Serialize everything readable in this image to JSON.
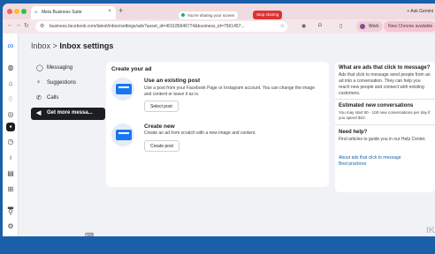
{
  "browser": {
    "tab_title": "Meta Business Suite",
    "new_tab": "+",
    "close": "×",
    "sharing_text": "You're sharing your screen",
    "stop_sharing": "Stop sharing",
    "ask_gemini": "+ Ask Gemini",
    "url": "business.facebook.com/latest/inbox/settings/ads?asset_id=401185646774&business_id=7561457...",
    "work_label": "Work",
    "chrome_available": "New Chrome available"
  },
  "page": {
    "breadcrumb_parent": "Inbox",
    "breadcrumb_sep": ">",
    "title": "Inbox settings"
  },
  "nav": {
    "items": [
      {
        "label": "Messaging",
        "icon": "chat-icon",
        "glyph": "◯"
      },
      {
        "label": "Suggestions",
        "icon": "lightbulb-icon",
        "glyph": "♀"
      },
      {
        "label": "Calls",
        "icon": "phone-icon",
        "glyph": "✆"
      },
      {
        "label": "Get more messa...",
        "icon": "megaphone-icon",
        "glyph": "◀"
      }
    ]
  },
  "create_ad": {
    "heading": "Create your ad",
    "existing": {
      "title": "Use an existing post",
      "description": "Use a post from your Facebook Page or Instagram account. You can change the image and content or leave it as is.",
      "button": "Select post"
    },
    "new": {
      "title": "Create new",
      "description": "Create an ad from scratch with a new image and content.",
      "button": "Create post"
    }
  },
  "sidebar_info": {
    "what_heading": "What are ads that click to message?",
    "what_text": "Ads that click to message send people from an ad into a conversation. They can help you reach new people and connect with existing customers.",
    "est_heading": "Estimated new conversations",
    "est_text": "You may start 90 - 100 new conversations per day if you spend $10.",
    "help_heading": "Need help?",
    "help_text": "Find articles to guide you in our Help Center.",
    "link1": "About ads that click to message",
    "link2": "Best practices"
  },
  "corner_mark": "IK",
  "colors": {
    "accent": "#1877f2",
    "background": "#f0f2f5",
    "frame": "#1b5fa8"
  }
}
